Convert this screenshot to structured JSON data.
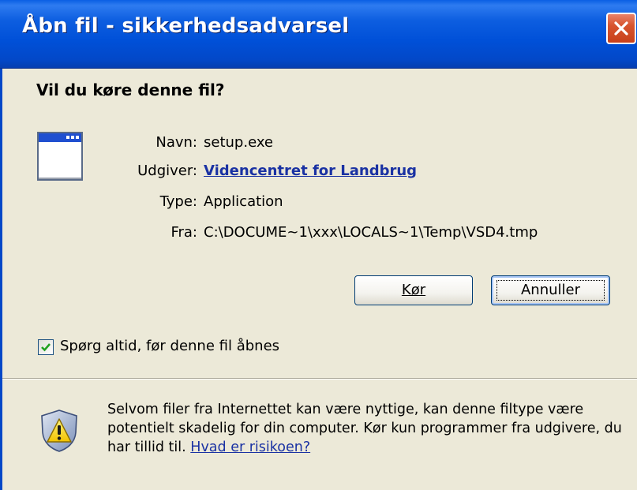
{
  "window": {
    "title": "Åbn fil - sikkerhedsadvarsel"
  },
  "dialog": {
    "question": "Vil du køre denne fil?",
    "fields": [
      {
        "label": "Navn:",
        "value": "setup.exe"
      },
      {
        "label": "Udgiver:",
        "value": "Videncentret for Landbrug"
      },
      {
        "label": "Type:",
        "value": "Application"
      },
      {
        "label": "Fra:",
        "value": "C:\\DOCUME~1\\xxx\\LOCALS~1\\Temp\\VSD4.tmp"
      }
    ],
    "buttons": {
      "run": "Kør",
      "cancel": "Annuller"
    },
    "checkbox": {
      "label": "Spørg altid, før denne fil åbnes",
      "checked": true
    },
    "warning": {
      "text": "Selvom filer fra Internettet kan være nyttige, kan denne filtype være potentielt skadelig for din computer. Kør kun programmer fra udgivere, du har tillid til.",
      "link": "Hvad er risikoen?"
    }
  },
  "icons": {
    "close": "close-icon",
    "app": "application-window-icon",
    "checkmark": "checkmark-icon",
    "warning": "security-shield-warning-icon"
  },
  "colors": {
    "titlebar": "#0050d8",
    "dialog_bg": "#ece9d8",
    "link": "#1a32a3",
    "close": "#d7542e"
  }
}
